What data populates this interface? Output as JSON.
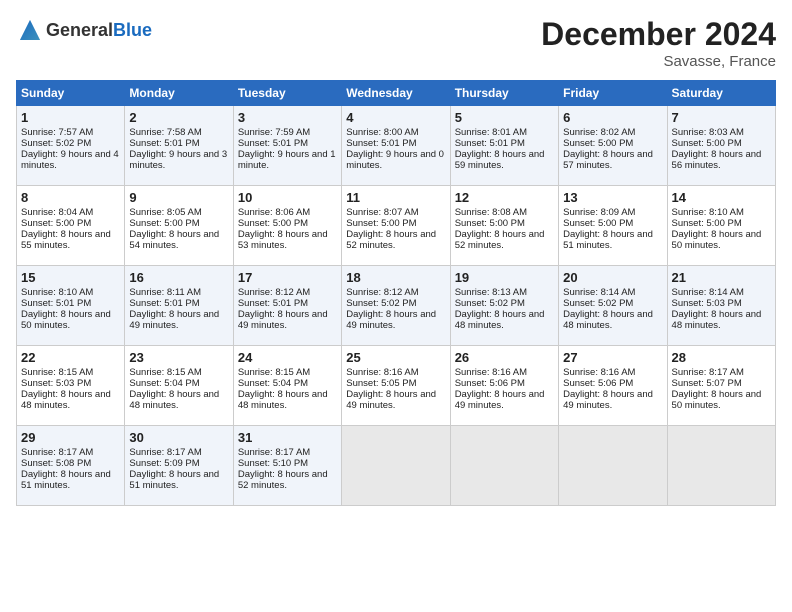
{
  "header": {
    "logo_general": "General",
    "logo_blue": "Blue",
    "month": "December 2024",
    "location": "Savasse, France"
  },
  "days_of_week": [
    "Sunday",
    "Monday",
    "Tuesday",
    "Wednesday",
    "Thursday",
    "Friday",
    "Saturday"
  ],
  "weeks": [
    [
      {
        "day": "1",
        "sunrise": "Sunrise: 7:57 AM",
        "sunset": "Sunset: 5:02 PM",
        "daylight": "Daylight: 9 hours and 4 minutes."
      },
      {
        "day": "2",
        "sunrise": "Sunrise: 7:58 AM",
        "sunset": "Sunset: 5:01 PM",
        "daylight": "Daylight: 9 hours and 3 minutes."
      },
      {
        "day": "3",
        "sunrise": "Sunrise: 7:59 AM",
        "sunset": "Sunset: 5:01 PM",
        "daylight": "Daylight: 9 hours and 1 minute."
      },
      {
        "day": "4",
        "sunrise": "Sunrise: 8:00 AM",
        "sunset": "Sunset: 5:01 PM",
        "daylight": "Daylight: 9 hours and 0 minutes."
      },
      {
        "day": "5",
        "sunrise": "Sunrise: 8:01 AM",
        "sunset": "Sunset: 5:01 PM",
        "daylight": "Daylight: 8 hours and 59 minutes."
      },
      {
        "day": "6",
        "sunrise": "Sunrise: 8:02 AM",
        "sunset": "Sunset: 5:00 PM",
        "daylight": "Daylight: 8 hours and 57 minutes."
      },
      {
        "day": "7",
        "sunrise": "Sunrise: 8:03 AM",
        "sunset": "Sunset: 5:00 PM",
        "daylight": "Daylight: 8 hours and 56 minutes."
      }
    ],
    [
      {
        "day": "8",
        "sunrise": "Sunrise: 8:04 AM",
        "sunset": "Sunset: 5:00 PM",
        "daylight": "Daylight: 8 hours and 55 minutes."
      },
      {
        "day": "9",
        "sunrise": "Sunrise: 8:05 AM",
        "sunset": "Sunset: 5:00 PM",
        "daylight": "Daylight: 8 hours and 54 minutes."
      },
      {
        "day": "10",
        "sunrise": "Sunrise: 8:06 AM",
        "sunset": "Sunset: 5:00 PM",
        "daylight": "Daylight: 8 hours and 53 minutes."
      },
      {
        "day": "11",
        "sunrise": "Sunrise: 8:07 AM",
        "sunset": "Sunset: 5:00 PM",
        "daylight": "Daylight: 8 hours and 52 minutes."
      },
      {
        "day": "12",
        "sunrise": "Sunrise: 8:08 AM",
        "sunset": "Sunset: 5:00 PM",
        "daylight": "Daylight: 8 hours and 52 minutes."
      },
      {
        "day": "13",
        "sunrise": "Sunrise: 8:09 AM",
        "sunset": "Sunset: 5:00 PM",
        "daylight": "Daylight: 8 hours and 51 minutes."
      },
      {
        "day": "14",
        "sunrise": "Sunrise: 8:10 AM",
        "sunset": "Sunset: 5:00 PM",
        "daylight": "Daylight: 8 hours and 50 minutes."
      }
    ],
    [
      {
        "day": "15",
        "sunrise": "Sunrise: 8:10 AM",
        "sunset": "Sunset: 5:01 PM",
        "daylight": "Daylight: 8 hours and 50 minutes."
      },
      {
        "day": "16",
        "sunrise": "Sunrise: 8:11 AM",
        "sunset": "Sunset: 5:01 PM",
        "daylight": "Daylight: 8 hours and 49 minutes."
      },
      {
        "day": "17",
        "sunrise": "Sunrise: 8:12 AM",
        "sunset": "Sunset: 5:01 PM",
        "daylight": "Daylight: 8 hours and 49 minutes."
      },
      {
        "day": "18",
        "sunrise": "Sunrise: 8:12 AM",
        "sunset": "Sunset: 5:02 PM",
        "daylight": "Daylight: 8 hours and 49 minutes."
      },
      {
        "day": "19",
        "sunrise": "Sunrise: 8:13 AM",
        "sunset": "Sunset: 5:02 PM",
        "daylight": "Daylight: 8 hours and 48 minutes."
      },
      {
        "day": "20",
        "sunrise": "Sunrise: 8:14 AM",
        "sunset": "Sunset: 5:02 PM",
        "daylight": "Daylight: 8 hours and 48 minutes."
      },
      {
        "day": "21",
        "sunrise": "Sunrise: 8:14 AM",
        "sunset": "Sunset: 5:03 PM",
        "daylight": "Daylight: 8 hours and 48 minutes."
      }
    ],
    [
      {
        "day": "22",
        "sunrise": "Sunrise: 8:15 AM",
        "sunset": "Sunset: 5:03 PM",
        "daylight": "Daylight: 8 hours and 48 minutes."
      },
      {
        "day": "23",
        "sunrise": "Sunrise: 8:15 AM",
        "sunset": "Sunset: 5:04 PM",
        "daylight": "Daylight: 8 hours and 48 minutes."
      },
      {
        "day": "24",
        "sunrise": "Sunrise: 8:15 AM",
        "sunset": "Sunset: 5:04 PM",
        "daylight": "Daylight: 8 hours and 48 minutes."
      },
      {
        "day": "25",
        "sunrise": "Sunrise: 8:16 AM",
        "sunset": "Sunset: 5:05 PM",
        "daylight": "Daylight: 8 hours and 49 minutes."
      },
      {
        "day": "26",
        "sunrise": "Sunrise: 8:16 AM",
        "sunset": "Sunset: 5:06 PM",
        "daylight": "Daylight: 8 hours and 49 minutes."
      },
      {
        "day": "27",
        "sunrise": "Sunrise: 8:16 AM",
        "sunset": "Sunset: 5:06 PM",
        "daylight": "Daylight: 8 hours and 49 minutes."
      },
      {
        "day": "28",
        "sunrise": "Sunrise: 8:17 AM",
        "sunset": "Sunset: 5:07 PM",
        "daylight": "Daylight: 8 hours and 50 minutes."
      }
    ],
    [
      {
        "day": "29",
        "sunrise": "Sunrise: 8:17 AM",
        "sunset": "Sunset: 5:08 PM",
        "daylight": "Daylight: 8 hours and 51 minutes."
      },
      {
        "day": "30",
        "sunrise": "Sunrise: 8:17 AM",
        "sunset": "Sunset: 5:09 PM",
        "daylight": "Daylight: 8 hours and 51 minutes."
      },
      {
        "day": "31",
        "sunrise": "Sunrise: 8:17 AM",
        "sunset": "Sunset: 5:10 PM",
        "daylight": "Daylight: 8 hours and 52 minutes."
      },
      {
        "day": "",
        "sunrise": "",
        "sunset": "",
        "daylight": ""
      },
      {
        "day": "",
        "sunrise": "",
        "sunset": "",
        "daylight": ""
      },
      {
        "day": "",
        "sunrise": "",
        "sunset": "",
        "daylight": ""
      },
      {
        "day": "",
        "sunrise": "",
        "sunset": "",
        "daylight": ""
      }
    ]
  ]
}
